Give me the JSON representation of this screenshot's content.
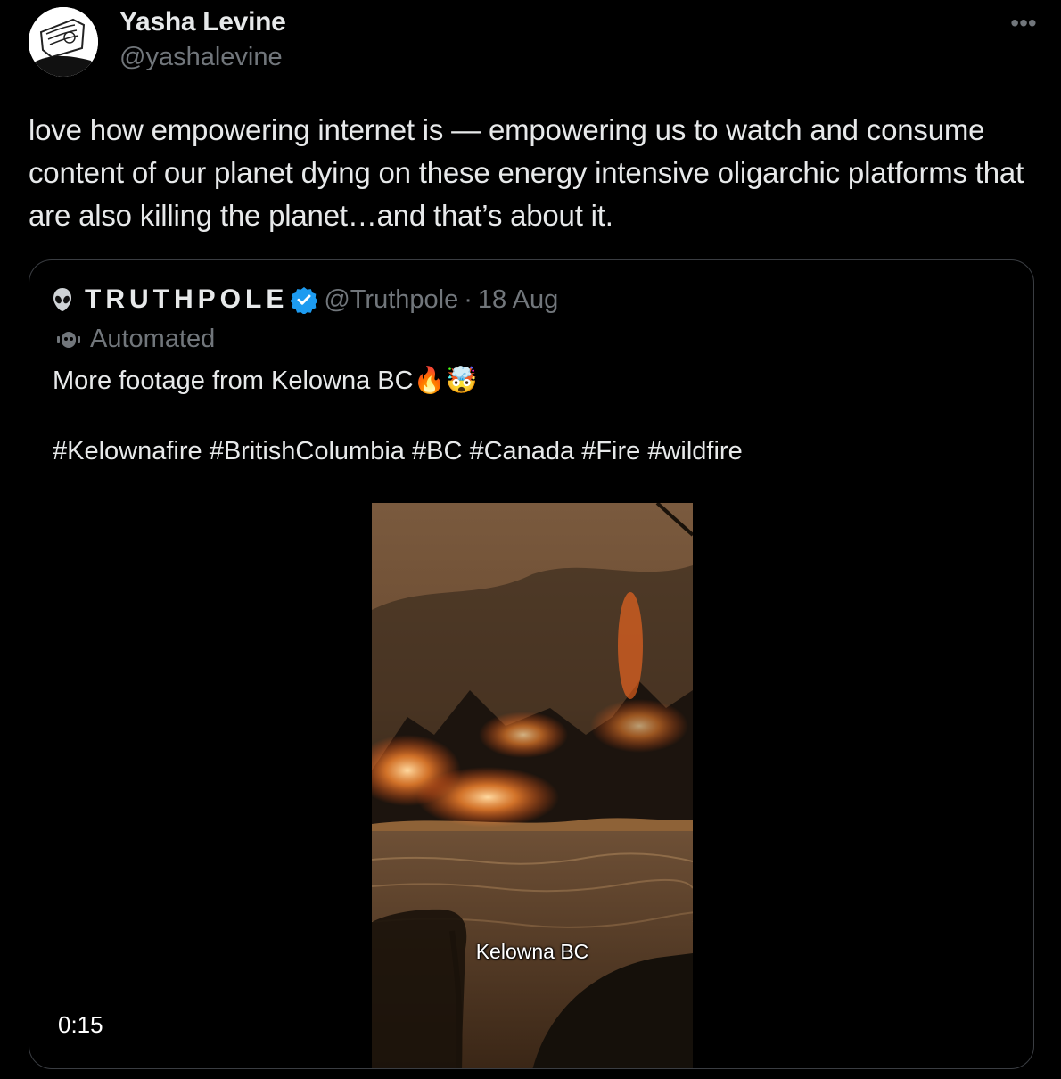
{
  "author": {
    "name": "Yasha Levine",
    "handle": "@yashalevine"
  },
  "more_icon": "more-horizontal-icon",
  "tweet_text": "love how empowering internet is — empowering us to watch and consume content of our planet dying on these energy intensive oligarchic platforms that are also killing the planet…and that’s about it.",
  "quoted": {
    "name": "TRUTHPOLE",
    "handle": "@Truthpole",
    "separator": "·",
    "date": "18 Aug",
    "automated_label": "Automated",
    "text": "More footage from Kelowna BC🔥🤯",
    "hashtags": "#Kelownafire #BritishColumbia #BC #Canada #Fire #wildfire",
    "video": {
      "caption": "Kelowna BC",
      "duration": "0:15"
    }
  },
  "colors": {
    "background": "#000000",
    "text_primary": "#e7e9ea",
    "text_secondary": "#71767b",
    "verified_badge": "#1d9bf0",
    "border": "#3a3d42"
  }
}
